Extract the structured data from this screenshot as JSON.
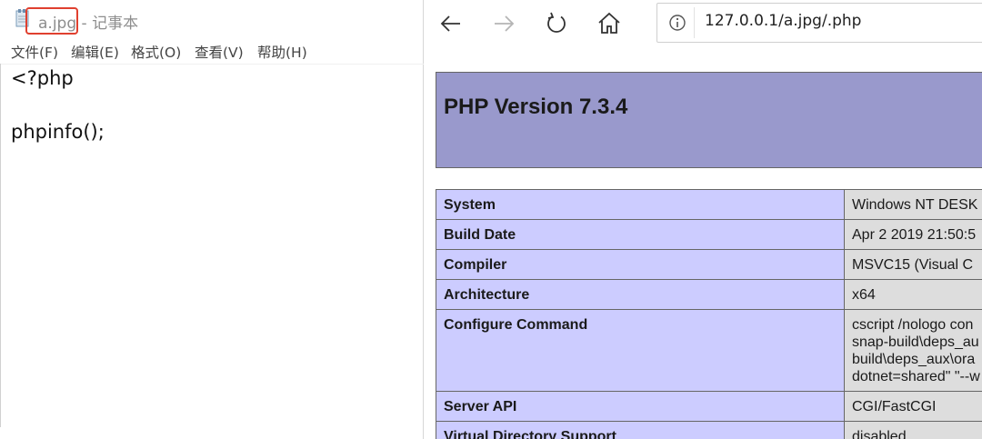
{
  "notepad": {
    "filename": "a.jpg",
    "app_name_suffix": " - 记事本",
    "menu": [
      "文件(F)",
      "编辑(E)",
      "格式(O)",
      "查看(V)",
      "帮助(H)"
    ],
    "content_lines": [
      "<?php",
      "",
      "phpinfo();"
    ]
  },
  "browser": {
    "url": "127.0.0.1/a.jpg/.php",
    "buttons": [
      "back-icon",
      "forward-icon",
      "refresh-icon",
      "home-icon"
    ],
    "php_version_title": "PHP Version 7.3.4",
    "info_rows": [
      {
        "key": "System",
        "value": "Windows NT DESK"
      },
      {
        "key": "Build Date",
        "value": "Apr 2 2019 21:50:5"
      },
      {
        "key": "Compiler",
        "value": "MSVC15 (Visual C"
      },
      {
        "key": "Architecture",
        "value": "x64"
      },
      {
        "key": "Configure Command",
        "value": "cscript /nologo con\nsnap-build\\deps_au\nbuild\\deps_aux\\ora\ndotnet=shared\" \"--w"
      },
      {
        "key": "Server API",
        "value": "CGI/FastCGI"
      },
      {
        "key": "Virtual Directory Support",
        "value": "disabled"
      }
    ]
  },
  "colors": {
    "header_bg": "#9999cc",
    "key_bg": "#ccccff",
    "value_bg": "#dddddd",
    "highlight_box": "#e0402f"
  }
}
